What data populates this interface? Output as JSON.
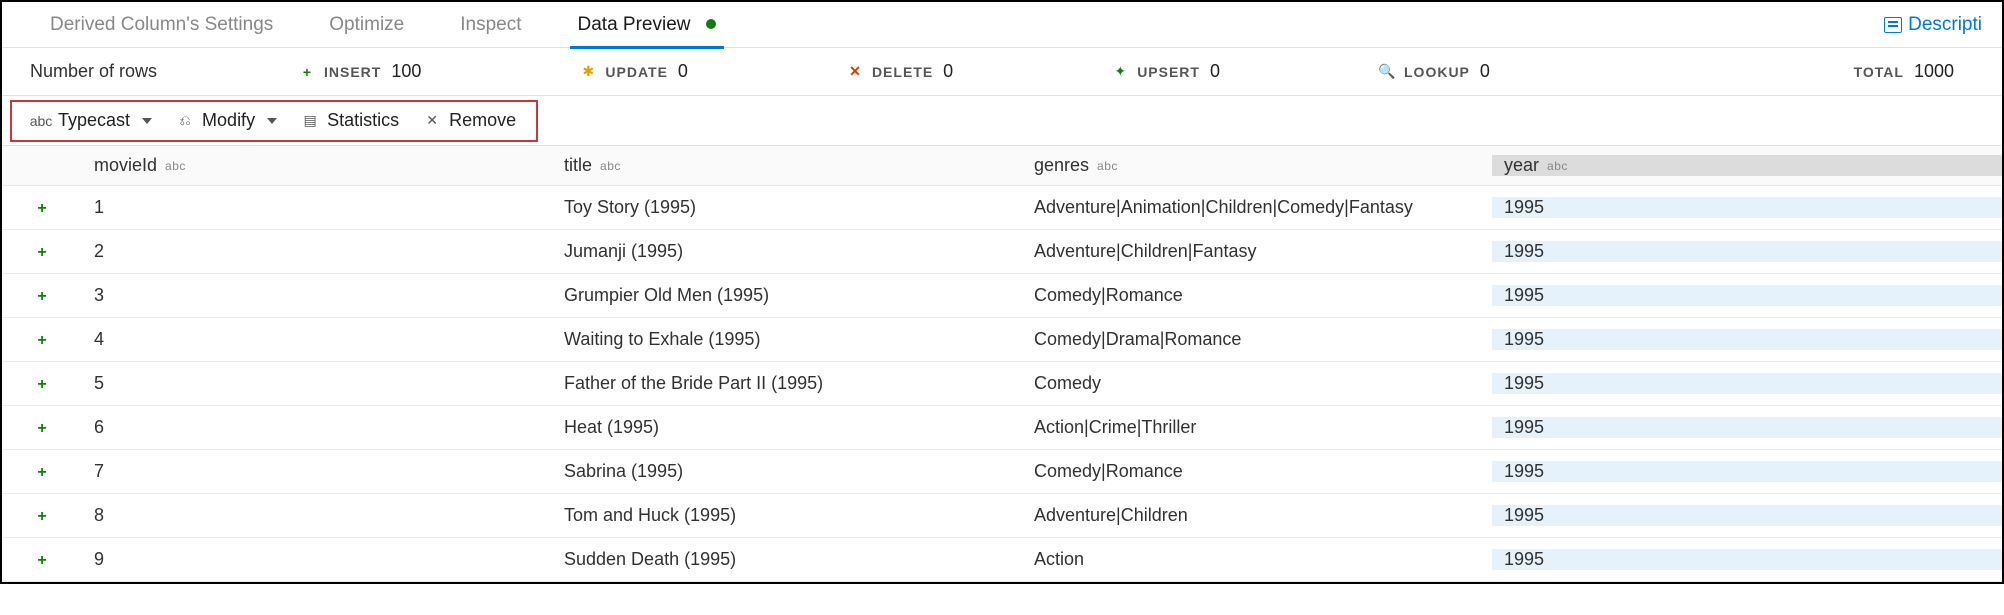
{
  "tabs": {
    "items": [
      {
        "label": "Derived Column's Settings",
        "active": false
      },
      {
        "label": "Optimize",
        "active": false
      },
      {
        "label": "Inspect",
        "active": false
      },
      {
        "label": "Data Preview",
        "active": true,
        "dot": true
      }
    ],
    "description_label": "Descripti"
  },
  "stats": {
    "label": "Number of rows",
    "insert": {
      "name": "INSERT",
      "value": "100"
    },
    "update": {
      "name": "UPDATE",
      "value": "0"
    },
    "delete": {
      "name": "DELETE",
      "value": "0"
    },
    "upsert": {
      "name": "UPSERT",
      "value": "0"
    },
    "lookup": {
      "name": "LOOKUP",
      "value": "0"
    },
    "total": {
      "name": "TOTAL",
      "value": "1000"
    }
  },
  "toolbar": {
    "typecast": "Typecast",
    "modify": "Modify",
    "statistics": "Statistics",
    "remove": "Remove"
  },
  "table": {
    "type_badge": "abc",
    "columns": [
      {
        "key": "movieId",
        "label": "movieId"
      },
      {
        "key": "title",
        "label": "title"
      },
      {
        "key": "genres",
        "label": "genres"
      },
      {
        "key": "year",
        "label": "year"
      }
    ],
    "rows": [
      {
        "movieId": "1",
        "title": "Toy Story (1995)",
        "genres": "Adventure|Animation|Children|Comedy|Fantasy",
        "year": "1995"
      },
      {
        "movieId": "2",
        "title": "Jumanji (1995)",
        "genres": "Adventure|Children|Fantasy",
        "year": "1995"
      },
      {
        "movieId": "3",
        "title": "Grumpier Old Men (1995)",
        "genres": "Comedy|Romance",
        "year": "1995"
      },
      {
        "movieId": "4",
        "title": "Waiting to Exhale (1995)",
        "genres": "Comedy|Drama|Romance",
        "year": "1995"
      },
      {
        "movieId": "5",
        "title": "Father of the Bride Part II (1995)",
        "genres": "Comedy",
        "year": "1995"
      },
      {
        "movieId": "6",
        "title": "Heat (1995)",
        "genres": "Action|Crime|Thriller",
        "year": "1995"
      },
      {
        "movieId": "7",
        "title": "Sabrina (1995)",
        "genres": "Comedy|Romance",
        "year": "1995"
      },
      {
        "movieId": "8",
        "title": "Tom and Huck (1995)",
        "genres": "Adventure|Children",
        "year": "1995"
      },
      {
        "movieId": "9",
        "title": "Sudden Death (1995)",
        "genres": "Action",
        "year": "1995"
      }
    ]
  }
}
